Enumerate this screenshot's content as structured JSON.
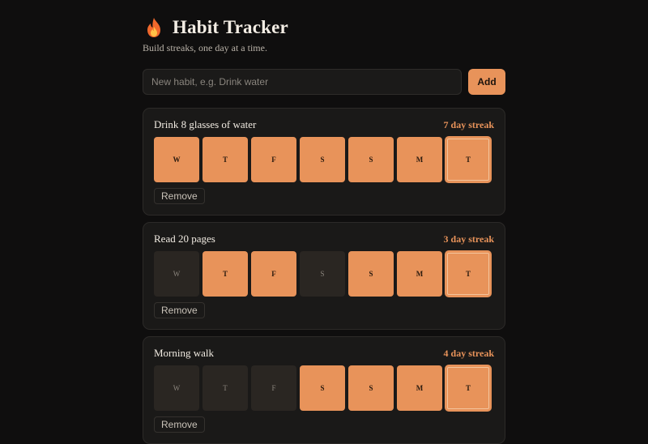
{
  "app": {
    "title": "Habit Tracker",
    "subtitle": "Build streaks, one day at a time.",
    "icon": "flame-icon",
    "accent_color": "#e8935a"
  },
  "add_form": {
    "placeholder": "New habit, e.g. Drink water",
    "value": "",
    "button_label": "Add"
  },
  "habits": [
    {
      "name": "Drink 8 glasses of water",
      "streak_label": "7 day streak",
      "remove_label": "Remove",
      "days": [
        {
          "label": "W",
          "done": true
        },
        {
          "label": "T",
          "done": true
        },
        {
          "label": "F",
          "done": true
        },
        {
          "label": "S",
          "done": true
        },
        {
          "label": "S",
          "done": true
        },
        {
          "label": "M",
          "done": true
        },
        {
          "label": "T",
          "done": true,
          "today": true
        }
      ]
    },
    {
      "name": "Read 20 pages",
      "streak_label": "3 day streak",
      "remove_label": "Remove",
      "days": [
        {
          "label": "W",
          "done": false
        },
        {
          "label": "T",
          "done": true
        },
        {
          "label": "F",
          "done": true
        },
        {
          "label": "S",
          "done": false
        },
        {
          "label": "S",
          "done": true
        },
        {
          "label": "M",
          "done": true
        },
        {
          "label": "T",
          "done": true,
          "today": true
        }
      ]
    },
    {
      "name": "Morning walk",
      "streak_label": "4 day streak",
      "remove_label": "Remove",
      "days": [
        {
          "label": "W",
          "done": false
        },
        {
          "label": "T",
          "done": false
        },
        {
          "label": "F",
          "done": false
        },
        {
          "label": "S",
          "done": true
        },
        {
          "label": "S",
          "done": true
        },
        {
          "label": "M",
          "done": true
        },
        {
          "label": "T",
          "done": true,
          "today": true
        }
      ]
    }
  ]
}
